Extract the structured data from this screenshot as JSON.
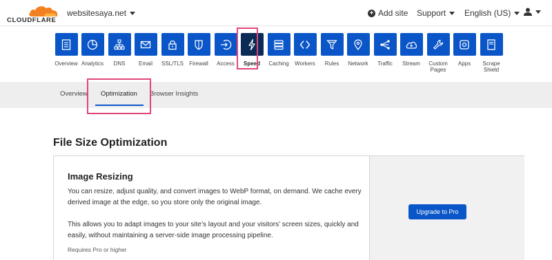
{
  "brand": {
    "wordmark": "CLOUDFLARE",
    "accent": "#f38020"
  },
  "header": {
    "site_name": "websitesaya.net",
    "add_site_label": "Add site",
    "support_label": "Support",
    "language_label": "English (US)"
  },
  "nav": {
    "active": "Speed",
    "tile_color": "#0a55c7",
    "active_tile_color": "#0b2a55",
    "items": [
      {
        "label": "Overview",
        "icon": "document-icon"
      },
      {
        "label": "Analytics",
        "icon": "pie-chart-icon"
      },
      {
        "label": "DNS",
        "icon": "network-icon"
      },
      {
        "label": "Email",
        "icon": "mail-icon"
      },
      {
        "label": "SSL/TLS",
        "icon": "lock-icon"
      },
      {
        "label": "Firewall",
        "icon": "shield-icon"
      },
      {
        "label": "Access",
        "icon": "sign-in-icon"
      },
      {
        "label": "Speed",
        "icon": "lightning-icon"
      },
      {
        "label": "Caching",
        "icon": "server-icon"
      },
      {
        "label": "Workers",
        "icon": "code-brackets-icon"
      },
      {
        "label": "Rules",
        "icon": "filter-icon"
      },
      {
        "label": "Network",
        "icon": "location-pin-icon"
      },
      {
        "label": "Traffic",
        "icon": "share-nodes-icon"
      },
      {
        "label": "Stream",
        "icon": "cloud-play-icon"
      },
      {
        "label": "Custom Pages",
        "icon": "wrench-icon"
      },
      {
        "label": "Apps",
        "icon": "app-square-icon"
      },
      {
        "label": "Scrape Shield",
        "icon": "page-icon"
      }
    ]
  },
  "subnav": {
    "tabs": [
      {
        "label": "Overview"
      },
      {
        "label": "Optimization",
        "active": true
      },
      {
        "label": "Browser Insights"
      }
    ]
  },
  "main": {
    "section_title": "File Size Optimization",
    "card": {
      "title": "Image Resizing",
      "paragraph1": "You can resize, adjust quality, and convert images to WebP format, on demand. We cache every derived image at the edge, so you store only the original image.",
      "paragraph2": "This allows you to adapt images to your site’s layout and your visitors’ screen sizes, quickly and easily, without maintaining a server-side image processing pipeline.",
      "requirement": "Requires Pro or higher",
      "button_label": "Upgrade to Pro"
    }
  },
  "highlight_color": "#e0457a"
}
